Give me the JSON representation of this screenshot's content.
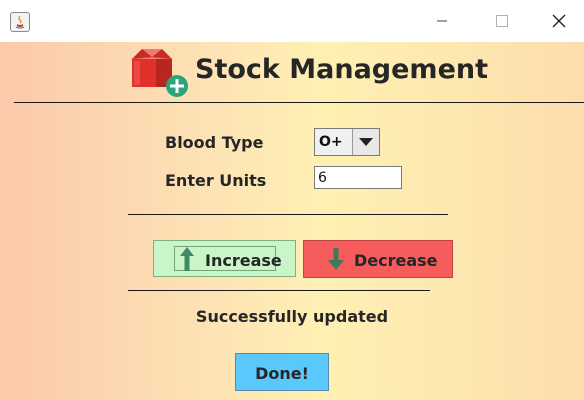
{
  "window": {
    "title": "",
    "controls": [
      "minimize-icon",
      "maximize-icon",
      "close-icon"
    ]
  },
  "header": {
    "title": "Stock Management",
    "logo_icon": "blood-bag-add-icon"
  },
  "form": {
    "blood_type_label": "Blood Type",
    "blood_type_value": "O+",
    "units_label": "Enter Units",
    "units_value": "6"
  },
  "actions": {
    "increase_label": "Increase",
    "increase_icon": "arrow-up-icon",
    "decrease_label": "Decrease",
    "decrease_icon": "arrow-down-icon"
  },
  "status_text": "Successfully updated",
  "done_label": "Done!",
  "colors": {
    "increase_bg": "#c9f6c9",
    "decrease_bg": "#f75c5c",
    "done_bg": "#5bc8fb",
    "logo_red": "#e0322b",
    "logo_plus": "#2aa57a"
  }
}
